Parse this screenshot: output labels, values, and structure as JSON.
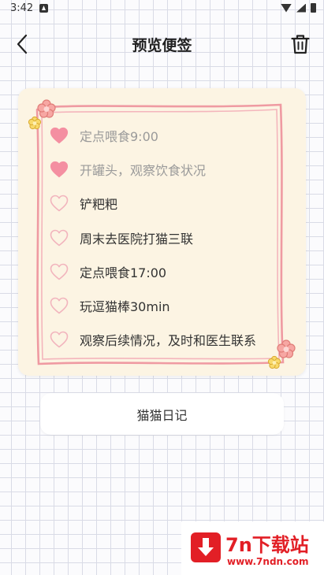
{
  "status_bar": {
    "time": "3:42"
  },
  "header": {
    "title": "预览便签"
  },
  "note": {
    "items": [
      {
        "text": "定点喂食9:00",
        "done": true
      },
      {
        "text": "开罐头，观察饮食状况",
        "done": true
      },
      {
        "text": "铲粑粑",
        "done": false
      },
      {
        "text": "周末去医院打猫三联",
        "done": false
      },
      {
        "text": "定点喂食17:00",
        "done": false
      },
      {
        "text": "玩逗猫棒30min",
        "done": false
      },
      {
        "text": "观察后续情况，及时和医生联系",
        "done": false
      }
    ]
  },
  "notebook_button": {
    "label": "猫猫日记"
  },
  "watermark": {
    "title": "7n下载站",
    "url": "www.7ndn.com"
  },
  "colors": {
    "frame": "#ef9aa2",
    "heart_filled": "#f48fa1",
    "heart_outline": "#f2b4bd",
    "brand_red": "#e21f26"
  }
}
